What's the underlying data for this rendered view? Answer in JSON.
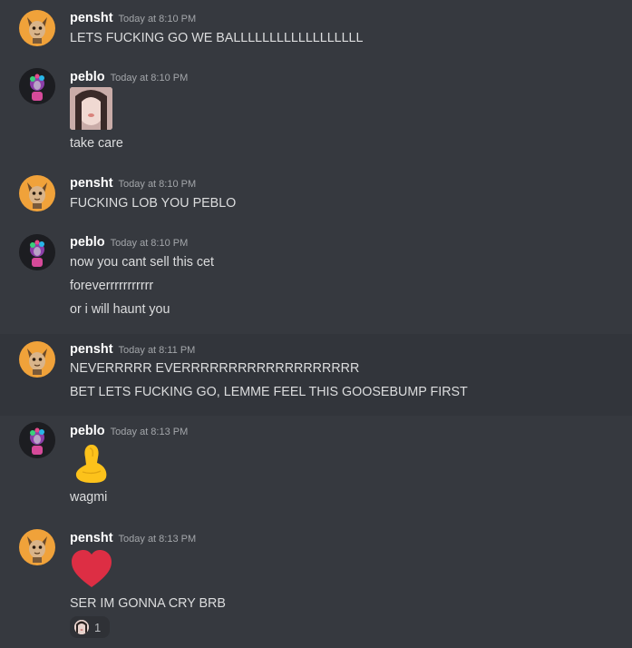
{
  "messages": [
    {
      "username": "pensht",
      "timestamp": "Today at 8:10 PM",
      "lines": [
        "LETS FUCKING GO WE BALLLLLLLLLLLLLLLLLL"
      ]
    },
    {
      "username": "peblo",
      "timestamp": "Today at 8:10 PM",
      "lines": [
        "take care"
      ]
    },
    {
      "username": "pensht",
      "timestamp": "Today at 8:10 PM",
      "lines": [
        "FUCKING LOB YOU PEBLO"
      ]
    },
    {
      "username": "peblo",
      "timestamp": "Today at 8:10 PM",
      "lines": [
        "now you cant sell this cet",
        "foreverrrrrrrrrrr",
        "or i will haunt you"
      ]
    },
    {
      "username": "pensht",
      "timestamp": "Today at 8:11 PM",
      "lines": [
        "NEVERRRRR EVERRRRRRRRRRRRRRRRRRR",
        "BET LETS FUCKING GO, LEMME FEEL THIS GOOSEBUMP FIRST"
      ]
    },
    {
      "username": "peblo",
      "timestamp": "Today at 8:13 PM",
      "lines": [
        "wagmi"
      ]
    },
    {
      "username": "pensht",
      "timestamp": "Today at 8:13 PM",
      "lines": [
        "SER IM GONNA CRY BRB"
      ]
    }
  ],
  "reaction": {
    "count": "1"
  },
  "colors": {
    "background": "#36393f",
    "hover": "#32353b",
    "username": "#ffffff",
    "timestamp": "#a3a6aa",
    "text": "#dcddde",
    "pensht_avatar": "#f0a23a",
    "heart": "#dd2e44",
    "pinch": "#fcc21b"
  },
  "icons": [
    "cat-avatar-icon",
    "peblo-avatar-icon",
    "pinched-fingers-emoji",
    "red-heart-emoji"
  ]
}
